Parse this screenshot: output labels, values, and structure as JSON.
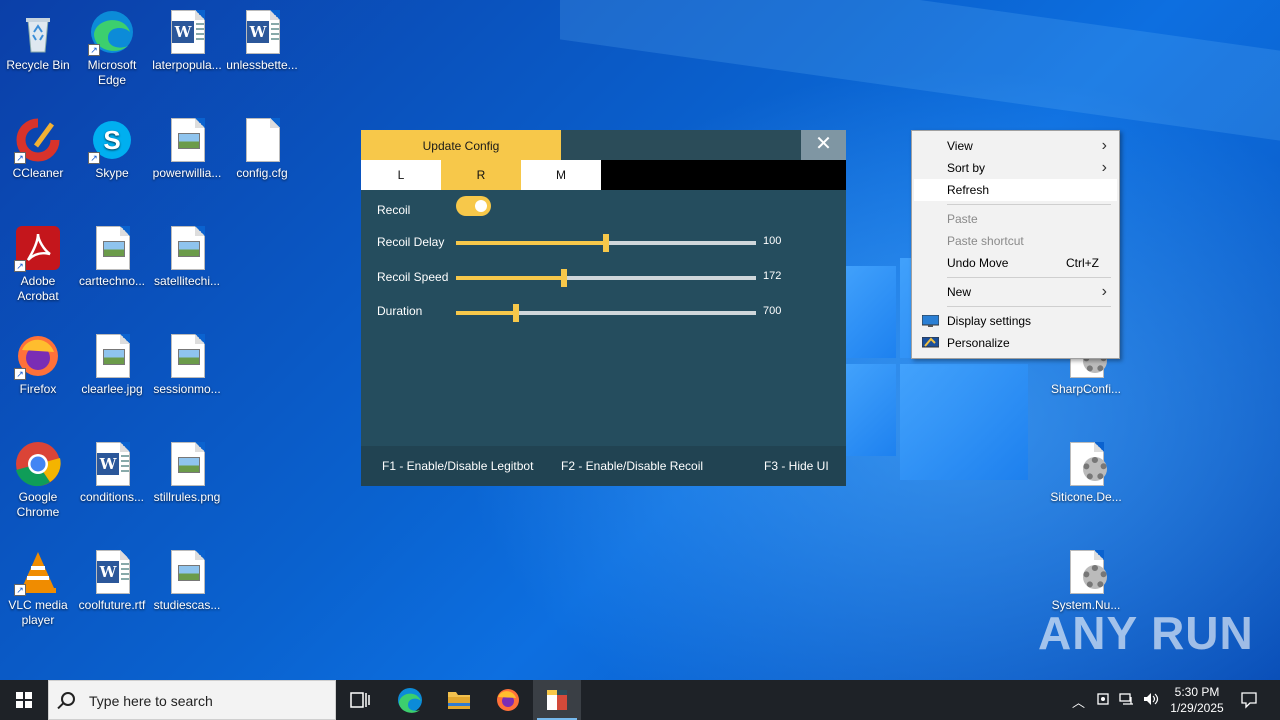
{
  "desktop": {
    "icons": [
      {
        "label": "Recycle Bin",
        "icon": "recycle-bin-icon"
      },
      {
        "label": "Microsoft Edge",
        "icon": "edge-icon"
      },
      {
        "label": "laterpopula...",
        "icon": "word-doc-icon"
      },
      {
        "label": "unlessbette...",
        "icon": "word-doc-icon"
      },
      {
        "label": "CCleaner",
        "icon": "ccleaner-icon"
      },
      {
        "label": "Skype",
        "icon": "skype-icon"
      },
      {
        "label": "powerwillia...",
        "icon": "image-file-icon"
      },
      {
        "label": "config.cfg",
        "icon": "blank-file-icon"
      },
      {
        "label": "Adobe Acrobat",
        "icon": "acrobat-icon"
      },
      {
        "label": "carttechno...",
        "icon": "image-file-icon"
      },
      {
        "label": "satellitechi...",
        "icon": "image-file-icon"
      },
      {
        "label": "Firefox",
        "icon": "firefox-icon"
      },
      {
        "label": "clearlee.jpg",
        "icon": "image-file-icon"
      },
      {
        "label": "sessionmo...",
        "icon": "image-file-icon"
      },
      {
        "label": "Google Chrome",
        "icon": "chrome-icon"
      },
      {
        "label": "conditions...",
        "icon": "word-doc-icon"
      },
      {
        "label": "stillrules.png",
        "icon": "image-file-icon"
      },
      {
        "label": "VLC media player",
        "icon": "vlc-icon"
      },
      {
        "label": "coolfuture.rtf",
        "icon": "word-doc-icon"
      },
      {
        "label": "studiescas...",
        "icon": "image-file-icon"
      },
      {
        "label": "SharpConfi...",
        "icon": "settings-file-icon"
      },
      {
        "label": "Siticone.De...",
        "icon": "settings-file-icon"
      },
      {
        "label": "System.Nu...",
        "icon": "settings-file-icon"
      }
    ]
  },
  "app": {
    "tab_update": "Update Config",
    "close_glyph": "✕",
    "mode_tabs": [
      "L",
      "R",
      "M"
    ],
    "active_mode": "R",
    "recoil_label": "Recoil",
    "recoil_enabled": true,
    "sliders": [
      {
        "label": "Recoil Delay",
        "value": "100",
        "fraction": 0.5
      },
      {
        "label": "Recoil Speed",
        "value": "172",
        "fraction": 0.36
      },
      {
        "label": "Duration",
        "value": "700",
        "fraction": 0.2
      }
    ],
    "hints": [
      "F1 - Enable/Disable Legitbot",
      "F2 - Enable/Disable Recoil",
      "F3 - Hide UI"
    ],
    "accent_color": "#f7c84a"
  },
  "context_menu": {
    "items": [
      {
        "label": "View",
        "submenu": true
      },
      {
        "label": "Sort by",
        "submenu": true
      },
      {
        "label": "Refresh"
      },
      {
        "label": "Paste",
        "disabled": true
      },
      {
        "label": "Paste shortcut",
        "disabled": true
      },
      {
        "label": "Undo Move",
        "shortcut": "Ctrl+Z"
      },
      {
        "label": "New",
        "submenu": true
      },
      {
        "label": "Display settings",
        "icon": "display-icon"
      },
      {
        "label": "Personalize",
        "icon": "personalize-icon"
      }
    ]
  },
  "taskbar": {
    "search_placeholder": "Type here to search",
    "time": "5:30 PM",
    "date": "1/29/2025"
  },
  "watermark": "ANY RUN"
}
